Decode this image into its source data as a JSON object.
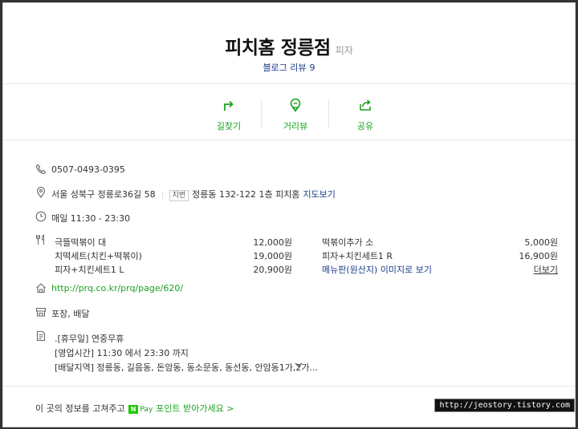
{
  "place": {
    "name": "피치홈 정릉점",
    "category": "피자",
    "review_label": "블로그 리뷰",
    "review_count": "9"
  },
  "actions": {
    "directions": "길찾기",
    "street_view": "거리뷰",
    "share": "공유"
  },
  "info": {
    "phone": "0507-0493-0395",
    "address": "서울 성북구 정릉로36길 58",
    "jibun_tag": "지번",
    "jibun_address": "정릉동 132-122 1층 피치홈",
    "map_link": "지도보기",
    "hours": "매일 11:30 - 23:30",
    "menu": [
      {
        "name": "극뜰떡볶이 대",
        "price": "12,000원"
      },
      {
        "name": "떡볶이추가 소",
        "price": "5,000원"
      },
      {
        "name": "치떡세트(치킨+떡볶이)",
        "price": "19,000원"
      },
      {
        "name": "피자+치킨세트1 R",
        "price": "16,900원"
      },
      {
        "name": "피자+치킨세트1 L",
        "price": "20,900원"
      }
    ],
    "menu_image_link": "메뉴판(원산지) 이미지로 보기",
    "menu_more": "더보기",
    "homepage": "http://prq.co.kr/prq/page/620/",
    "services": "포장, 배달",
    "notes": [
      ".[휴무일] 연중무휴",
      "[영업시간] 11:30 에서 23:30 까지",
      "[배달지역] 정릉동, 길음동, 돈암동, 동소문동, 동선동, 안암동1가,2가..."
    ]
  },
  "footer": {
    "text": "이 곳의 정보를 고쳐주고",
    "npay_n": "N",
    "npay_pay": "Pay",
    "point_link": "포인트 받아가세요 >"
  },
  "watermark": "http://jeostory.tistory.com",
  "colors": {
    "accent_green": "#1aa31e",
    "link_blue": "#1b3c8c",
    "npay_green": "#1ec800"
  }
}
